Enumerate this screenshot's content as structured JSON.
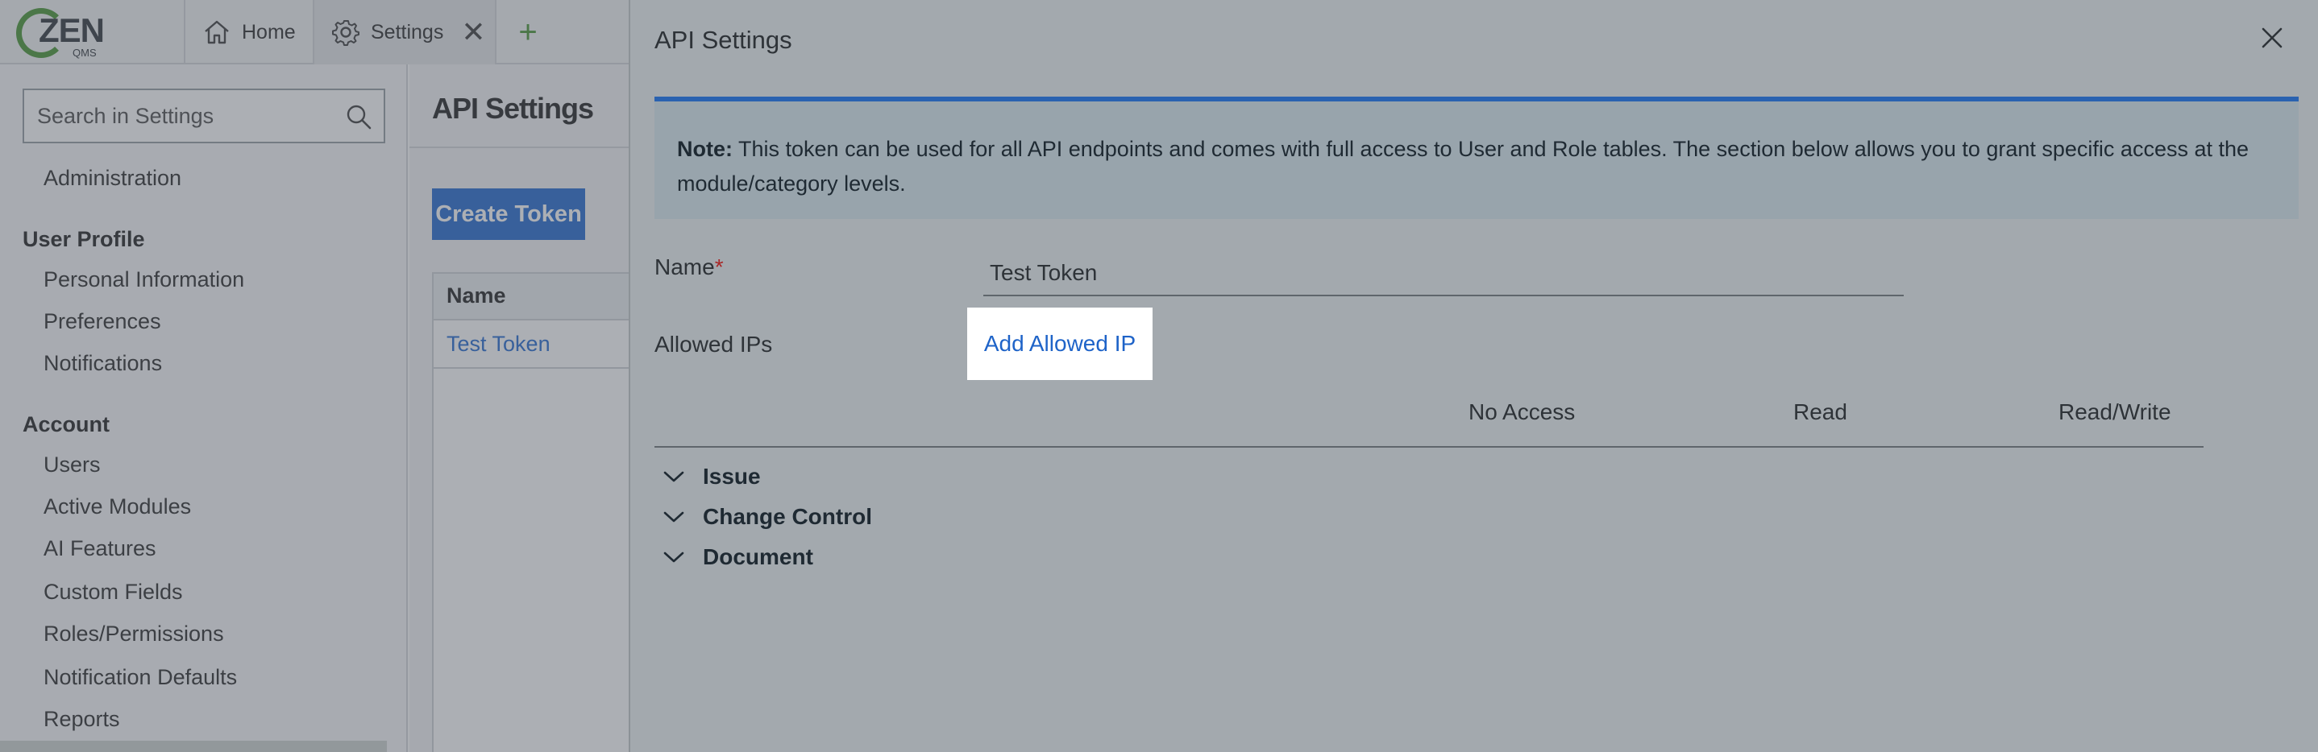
{
  "app": {
    "logo_text": "ZEN",
    "logo_sub": "QMS",
    "tabs": [
      {
        "label": "Home"
      },
      {
        "label": "Settings"
      }
    ]
  },
  "sidebar": {
    "search_placeholder": "Search in Settings",
    "items": {
      "administration": "Administration",
      "user_profile": "User Profile",
      "personal_information": "Personal Information",
      "preferences": "Preferences",
      "notifications": "Notifications",
      "account": "Account",
      "users": "Users",
      "active_modules": "Active Modules",
      "ai_features": "AI Features",
      "custom_fields": "Custom Fields",
      "roles_permissions": "Roles/Permissions",
      "notification_defaults": "Notification Defaults",
      "reports": "Reports"
    }
  },
  "content": {
    "title": "API Settings",
    "create_button": "Create Token",
    "table": {
      "header": "Name",
      "rows": [
        "Test Token"
      ]
    }
  },
  "dialog": {
    "title": "API Settings",
    "note_label": "Note:",
    "note_text": " This token can be used for all API endpoints and comes with full access to User and Role tables. The section below allows you to grant specific access at the module/category levels.",
    "name_label": "Name",
    "required_mark": "*",
    "name_value": "Test Token",
    "allowed_ips_label": "Allowed IPs",
    "add_ip_link": "Add Allowed IP",
    "permission_columns": [
      "No Access",
      "Read",
      "Read/Write"
    ],
    "modules": [
      "Issue",
      "Change Control",
      "Document"
    ]
  },
  "colors": {
    "accent_blue": "#2c6fd1",
    "link_blue": "#1e63c8",
    "brand_green": "#4f9a3b",
    "note_border": "#2a62b0",
    "required_red": "#a82828"
  },
  "icons": {
    "home": "home-icon",
    "settings": "gear-icon",
    "close_tab": "close-icon",
    "add_tab": "plus-icon",
    "search": "search-icon",
    "dialog_close": "close-icon",
    "expand": "chevron-down-icon"
  }
}
